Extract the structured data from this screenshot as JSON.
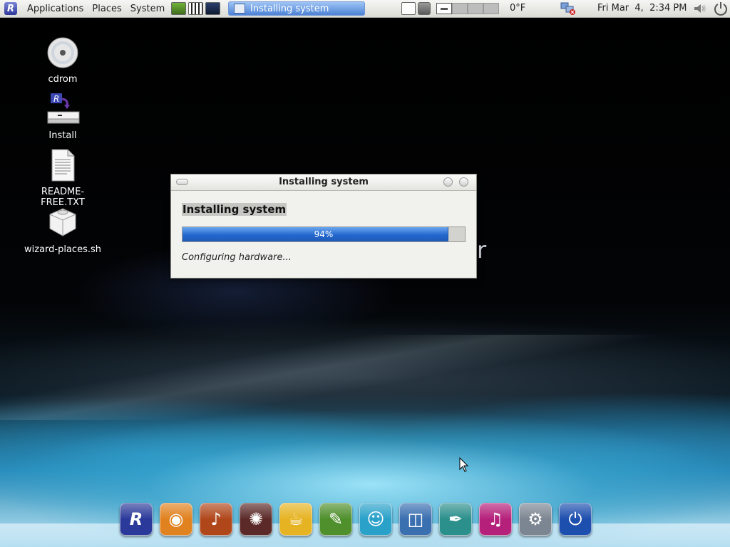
{
  "top_panel": {
    "menus": [
      "Applications",
      "Places",
      "System"
    ],
    "taskbar_window": "Installing system",
    "weather": "0°F",
    "clock": "Fri Mar  4,  2:34 PM"
  },
  "desktop": {
    "icons": [
      {
        "label": "cdrom",
        "icon": "cdrom-icon"
      },
      {
        "label": "Install",
        "icon": "install-icon"
      },
      {
        "label": "README-FREE.TXT",
        "icon": "text-file-icon"
      },
      {
        "label": "wizard-places.sh",
        "icon": "script-file-icon"
      }
    ]
  },
  "dialog": {
    "title": "Installing system",
    "heading": "Installing system",
    "progress": 0.94,
    "progress_text": "94%",
    "status": "Configuring hardware..."
  },
  "dock": {
    "items": [
      {
        "icon": "distro-logo-icon",
        "color": "#2b3a9a"
      },
      {
        "icon": "firefox-icon",
        "color": "#e0821f"
      },
      {
        "icon": "guitar-icon",
        "color": "#b0471b"
      },
      {
        "icon": "media-player-icon",
        "color": "#5b2a28"
      },
      {
        "icon": "coffee-icon",
        "color": "#e6b322"
      },
      {
        "icon": "graphics-editor-icon",
        "color": "#4f8f2c"
      },
      {
        "icon": "messenger-icon",
        "color": "#2aa1c9"
      },
      {
        "icon": "office-icon",
        "color": "#3a6fb0"
      },
      {
        "icon": "feather-writer-icon",
        "color": "#2b8f8c"
      },
      {
        "icon": "music-icon",
        "color": "#b5207a"
      },
      {
        "icon": "settings-icon",
        "color": "#7c8592"
      },
      {
        "icon": "power-icon",
        "color": "#1d4fae"
      }
    ]
  },
  "colors": {
    "accent": "#2467cc",
    "panel": "#e8e8e3",
    "taskbar_active": "#4d83d6"
  }
}
